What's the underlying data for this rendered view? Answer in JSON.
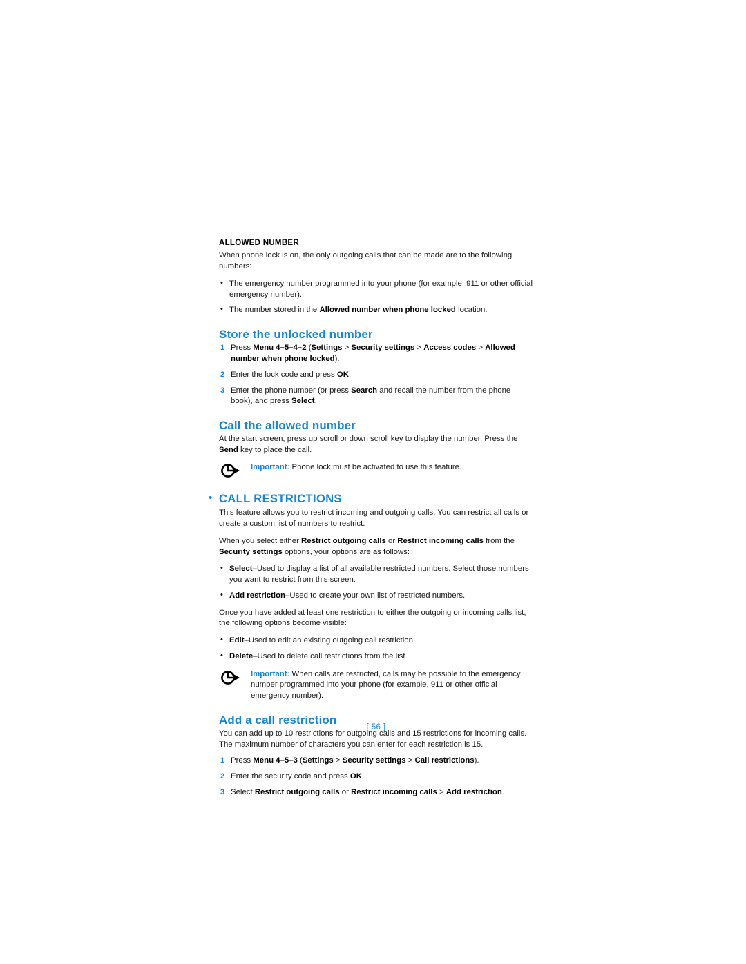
{
  "page": {
    "folio": "[ 56 ]",
    "accent_color": "#1685d8",
    "text_color": "#1a1a1a",
    "background": "#ffffff"
  },
  "allowed_number": {
    "heading": "ALLOWED NUMBER",
    "intro": "When phone lock is on, the only outgoing calls that can be made are to the following numbers:",
    "bullets": [
      {
        "pre": "The emergency number programmed into your phone (for example, 911 or other official emergency number).",
        "bold": "",
        "post": ""
      },
      {
        "pre": "The number stored in the ",
        "bold": "Allowed number when phone locked",
        "post": " location."
      }
    ]
  },
  "store_unlocked": {
    "heading": "Store the unlocked number",
    "steps": [
      {
        "p1": "Press ",
        "b1": "Menu 4–5–4–2 ",
        "p2": "(",
        "b2": "Settings",
        "p3": " > ",
        "b3": "Security settings",
        "p4": " > ",
        "b4": "Access codes",
        "p5": " > ",
        "b5": "Allowed number when phone locked",
        "p6": ")."
      },
      {
        "p1": "Enter the lock code and press ",
        "b1": "OK",
        "p2": "."
      },
      {
        "p1": "Enter the phone number (or press ",
        "b1": "Search",
        "p2": " and recall the number from the phone book), and press ",
        "b2": "Select",
        "p3": "."
      }
    ]
  },
  "call_allowed": {
    "heading": "Call the allowed number",
    "body_pre": "At the start screen, press up scroll or down scroll key to display the number. Press the ",
    "body_bold": "Send",
    "body_post": " key to place the call.",
    "note": {
      "icon": "important-arrow-icon",
      "label": "Important:",
      "text": " Phone lock must be activated to use this feature."
    }
  },
  "call_restrictions": {
    "bullet": "•",
    "heading": "CALL RESTRICTIONS",
    "intro": "This feature allows you to restrict incoming and outgoing calls. You can restrict all calls or create a custom list of numbers to restrict.",
    "select_intro": {
      "p1": "When you select either ",
      "b1": "Restrict outgoing calls",
      "p2": " or ",
      "b2": "Restrict incoming calls",
      "p3": " from the ",
      "b3": "Security settings",
      "p4": " options, your options are as follows:"
    },
    "options": [
      {
        "bold": "Select",
        "text": "–Used to display a list of all available restricted numbers. Select those numbers you want to restrict from this screen."
      },
      {
        "bold": "Add restriction",
        "text": "–Used to create your own list of restricted numbers."
      }
    ],
    "visible_intro": "Once you have added at least one restriction to either the outgoing or incoming calls list, the following options become visible:",
    "visible_options": [
      {
        "bold": "Edit",
        "text": "–Used to edit an existing outgoing call restriction"
      },
      {
        "bold": "Delete",
        "text": "–Used to delete call restrictions from the list"
      }
    ],
    "note": {
      "icon": "important-arrow-icon",
      "label": "Important:",
      "text": " When calls are restricted, calls may be possible to the emergency number programmed into your phone (for example, 911 or other official emergency number)."
    }
  },
  "add_restriction": {
    "heading": "Add a call restriction",
    "intro": "You can add up to 10 restrictions for outgoing calls and 15 restrictions for incoming calls. The maximum number of characters you can enter for each restriction is 15.",
    "steps": [
      {
        "p1": "Press ",
        "b1": "Menu 4–5–3 ",
        "p2": "(",
        "b2": "Settings",
        "p3": " > ",
        "b3": "Security settings",
        "p4": " > ",
        "b4": "Call restrictions",
        "p5": ")."
      },
      {
        "p1": "Enter the security code and press ",
        "b1": "OK",
        "p2": "."
      },
      {
        "p1": "Select ",
        "b1": "Restrict outgoing calls",
        "p2": " or ",
        "b2": "Restrict incoming calls",
        "p3": " > ",
        "b3": "Add restriction",
        "p4": "."
      }
    ]
  }
}
